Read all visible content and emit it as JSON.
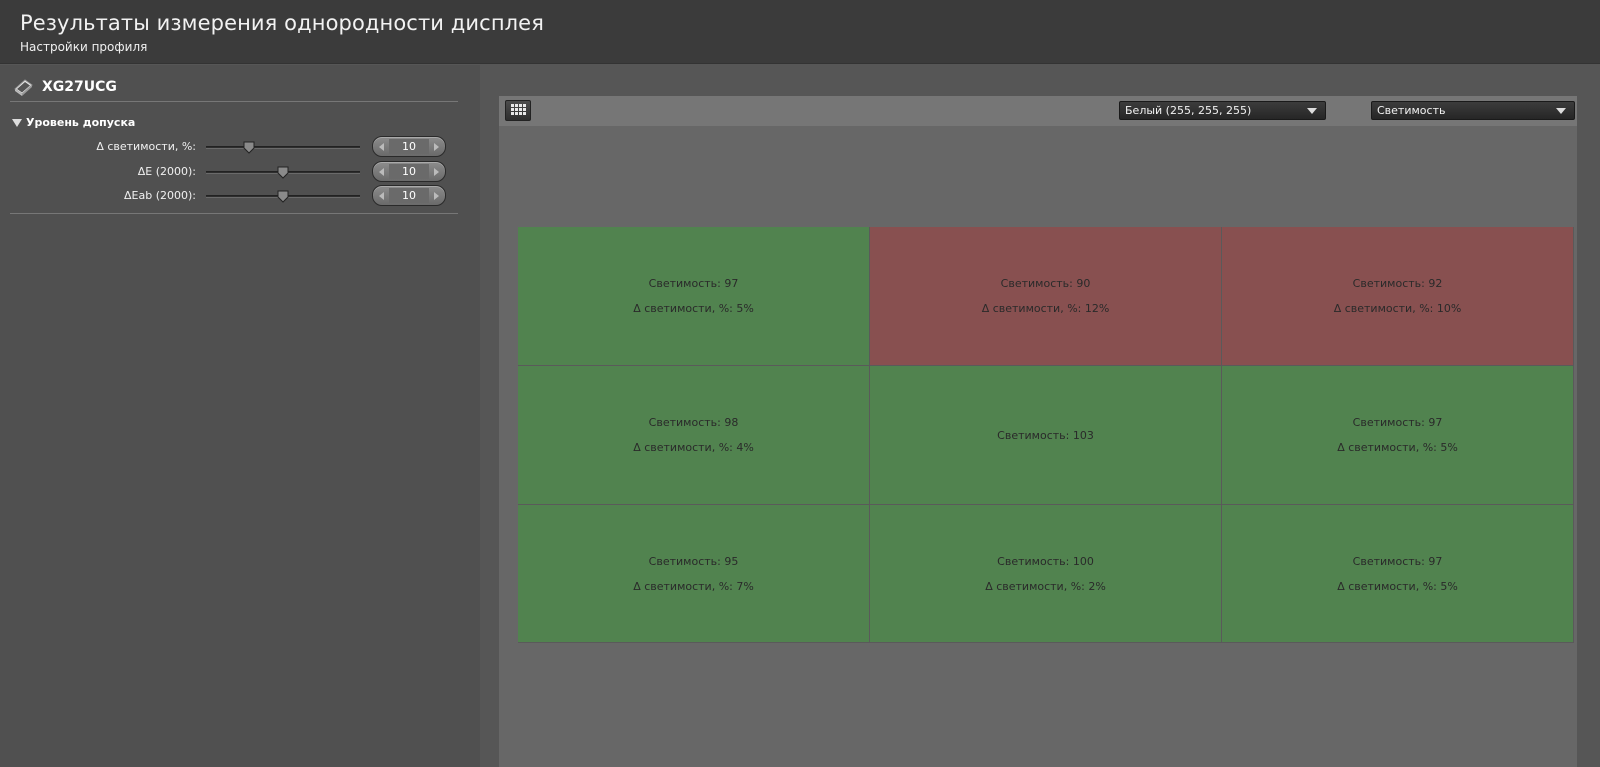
{
  "header": {
    "title": "Результаты измерения однородности дисплея",
    "subtitle": "Настройки профиля"
  },
  "sidebar": {
    "device_name": "XG27UCG",
    "section_label": "Уровень допуска",
    "params": [
      {
        "label": "Δ светимости, %:",
        "value": "10",
        "slider_level": 0.28
      },
      {
        "label": "ΔE (2000):",
        "value": "10",
        "slider_level": 0.5
      },
      {
        "label": "ΔEab (2000):",
        "value": "10",
        "slider_level": 0.5
      }
    ]
  },
  "toolbar": {
    "color_select": "Белый (255, 255, 255)",
    "metric_select": "Светимость"
  },
  "colors": {
    "pass": "#51834f",
    "fail": "#885050"
  },
  "grid": {
    "cells": [
      {
        "status": "pass",
        "lum": "Светимость: 97",
        "delta": "Δ светимости, %: 5%"
      },
      {
        "status": "fail",
        "lum": "Светимость: 90",
        "delta": "Δ светимости, %: 12%"
      },
      {
        "status": "fail",
        "lum": "Светимость: 92",
        "delta": "Δ светимости, %: 10%"
      },
      {
        "status": "pass",
        "lum": "Светимость: 98",
        "delta": "Δ светимости, %: 4%"
      },
      {
        "status": "pass",
        "lum": "Светимость: 103",
        "delta": ""
      },
      {
        "status": "pass",
        "lum": "Светимость: 97",
        "delta": "Δ светимости, %: 5%"
      },
      {
        "status": "pass",
        "lum": "Светимость: 95",
        "delta": "Δ светимости, %: 7%"
      },
      {
        "status": "pass",
        "lum": "Светимость: 100",
        "delta": "Δ светимости, %: 2%"
      },
      {
        "status": "pass",
        "lum": "Светимость: 97",
        "delta": "Δ светимости, %: 5%"
      }
    ]
  }
}
